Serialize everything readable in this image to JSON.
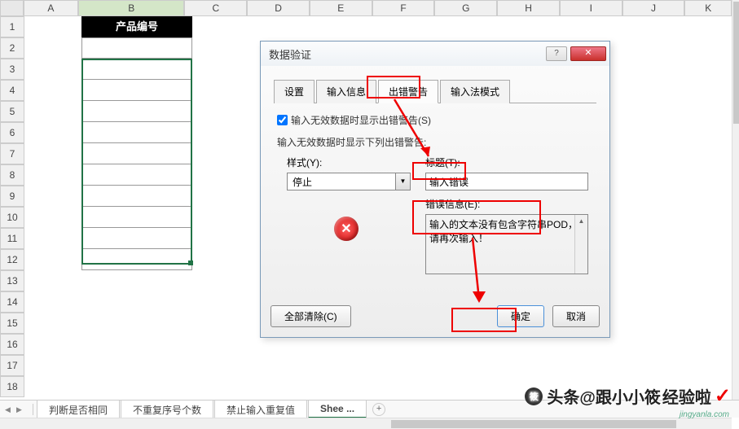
{
  "columns": [
    "A",
    "B",
    "C",
    "D",
    "E",
    "F",
    "G",
    "H",
    "I",
    "J",
    "K"
  ],
  "rows": [
    "1",
    "2",
    "3",
    "4",
    "5",
    "6",
    "7",
    "8",
    "9",
    "10",
    "11",
    "12",
    "13",
    "14",
    "15",
    "16",
    "17",
    "18"
  ],
  "product": {
    "header": "产品编号"
  },
  "sheet_tabs": {
    "t1": "判断是否相同",
    "t2": "不重复序号个数",
    "t3": "禁止输入重复值",
    "t4": "Shee ..."
  },
  "dialog": {
    "title": "数据验证",
    "tabs": {
      "t0": "设置",
      "t1": "输入信息",
      "t2": "出错警告",
      "t3": "输入法模式"
    },
    "checkbox_label": "输入无效数据时显示出错警告(S)",
    "section_label": "输入无效数据时显示下列出错警告:",
    "style_label": "样式(Y):",
    "style_value": "停止",
    "title_label": "标题(T):",
    "title_value": "输入错误",
    "msg_label": "错误信息(E):",
    "msg_value": "输入的文本没有包含字符串POD，请再次输入！",
    "clear_btn": "全部清除(C)",
    "ok_btn": "确定",
    "cancel_btn": "取消"
  },
  "watermark": {
    "prefix": "头条@跟小小筱",
    "suffix": "经验啦",
    "url": "jingyanla.com"
  }
}
